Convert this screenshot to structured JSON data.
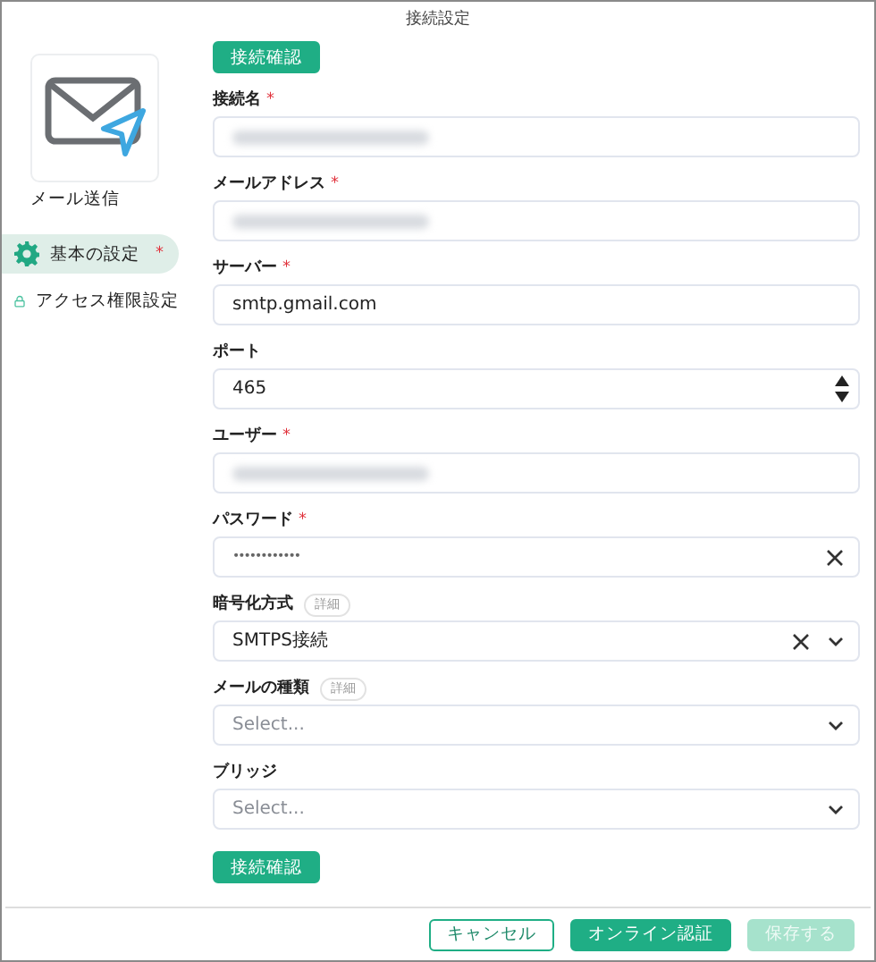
{
  "window": {
    "title": "接続設定"
  },
  "required_mark": "*",
  "sidebar": {
    "app_name": "メール送信",
    "items": [
      {
        "label": "基本の設定",
        "required": true,
        "selected": true
      },
      {
        "label": "アクセス権限設定",
        "required": false,
        "selected": false
      }
    ]
  },
  "top_button": "接続確認",
  "fields": [
    {
      "label": "接続名",
      "required": true,
      "kind": "text",
      "redacted": true
    },
    {
      "label": "メールアドレス",
      "required": true,
      "kind": "text",
      "redacted": true
    },
    {
      "label": "サーバー",
      "required": true,
      "kind": "text",
      "value": "smtp.gmail.com"
    },
    {
      "label": "ポート",
      "required": false,
      "kind": "number",
      "value": "465"
    },
    {
      "label": "ユーザー",
      "required": true,
      "kind": "text",
      "redacted": true
    },
    {
      "label": "パスワード",
      "required": true,
      "kind": "password",
      "value": "••••••••••••"
    },
    {
      "label": "暗号化方式",
      "required": false,
      "badge": "詳細",
      "kind": "select",
      "value": "SMTPS接続",
      "clearable": true
    },
    {
      "label": "メールの種類",
      "required": false,
      "badge": "詳細",
      "kind": "select",
      "placeholder": "Select..."
    },
    {
      "label": "ブリッジ",
      "required": false,
      "kind": "select",
      "placeholder": "Select..."
    }
  ],
  "bottom_button": "接続確認",
  "footer": [
    {
      "label": "キャンセル",
      "kind": "outline",
      "disabled": false
    },
    {
      "label": "オンライン認証",
      "kind": "primary",
      "disabled": false
    },
    {
      "label": "保存する",
      "kind": "primary",
      "disabled": true
    }
  ]
}
